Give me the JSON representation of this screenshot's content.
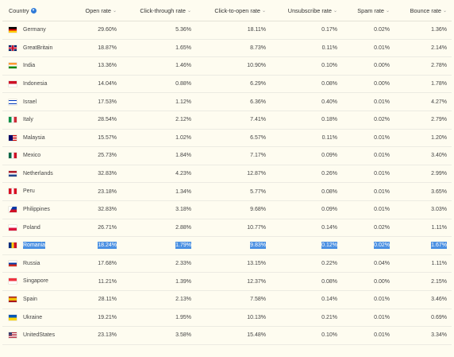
{
  "table": {
    "headers": {
      "country": "Country",
      "open_rate": "Open rate",
      "click_through_rate": "Click-through rate",
      "click_to_open_rate": "Click-to-open rate",
      "unsubscribe_rate": "Unsubscribe rate",
      "spam_rate": "Spam rate",
      "bounce_rate": "Bounce rate"
    },
    "rows": [
      {
        "country": "Germany",
        "flag": "flag-germany",
        "open": "29.60%",
        "ctr": "5.36%",
        "ctor": "18.11%",
        "unsub": "0.17%",
        "spam": "0.02%",
        "bounce": "1.36%"
      },
      {
        "country": "GreatBritain",
        "flag": "flag-great-britain",
        "open": "18.87%",
        "ctr": "1.65%",
        "ctor": "8.73%",
        "unsub": "0.11%",
        "spam": "0.01%",
        "bounce": "2.14%"
      },
      {
        "country": "India",
        "flag": "flag-india",
        "open": "13.36%",
        "ctr": "1.46%",
        "ctor": "10.90%",
        "unsub": "0.10%",
        "spam": "0.00%",
        "bounce": "2.78%"
      },
      {
        "country": "Indonesia",
        "flag": "flag-indonesia",
        "open": "14.04%",
        "ctr": "0.88%",
        "ctor": "6.29%",
        "unsub": "0.08%",
        "spam": "0.00%",
        "bounce": "1.78%"
      },
      {
        "country": "Israel",
        "flag": "flag-israel",
        "open": "17.53%",
        "ctr": "1.12%",
        "ctor": "6.36%",
        "unsub": "0.40%",
        "spam": "0.01%",
        "bounce": "4.27%"
      },
      {
        "country": "Italy",
        "flag": "flag-italy",
        "open": "28.54%",
        "ctr": "2.12%",
        "ctor": "7.41%",
        "unsub": "0.18%",
        "spam": "0.02%",
        "bounce": "2.79%"
      },
      {
        "country": "Malaysia",
        "flag": "flag-malaysia",
        "open": "15.57%",
        "ctr": "1.02%",
        "ctor": "6.57%",
        "unsub": "0.11%",
        "spam": "0.01%",
        "bounce": "1.20%"
      },
      {
        "country": "Mexico",
        "flag": "flag-mexico",
        "open": "25.73%",
        "ctr": "1.84%",
        "ctor": "7.17%",
        "unsub": "0.09%",
        "spam": "0.01%",
        "bounce": "3.40%"
      },
      {
        "country": "Netherlands",
        "flag": "flag-netherlands",
        "open": "32.83%",
        "ctr": "4.23%",
        "ctor": "12.87%",
        "unsub": "0.26%",
        "spam": "0.01%",
        "bounce": "2.99%"
      },
      {
        "country": "Peru",
        "flag": "flag-peru",
        "open": "23.18%",
        "ctr": "1.34%",
        "ctor": "5.77%",
        "unsub": "0.08%",
        "spam": "0.01%",
        "bounce": "3.65%"
      },
      {
        "country": "Philippines",
        "flag": "flag-philippines",
        "open": "32.83%",
        "ctr": "3.18%",
        "ctor": "9.68%",
        "unsub": "0.09%",
        "spam": "0.01%",
        "bounce": "3.03%"
      },
      {
        "country": "Poland",
        "flag": "flag-poland",
        "open": "26.71%",
        "ctr": "2.88%",
        "ctor": "10.77%",
        "unsub": "0.14%",
        "spam": "0.02%",
        "bounce": "1.11%"
      },
      {
        "country": "Romania",
        "flag": "flag-romania",
        "open": "18.24%",
        "ctr": "1.79%",
        "ctor": "9.83%",
        "unsub": "0.12%",
        "spam": "0.02%",
        "bounce": "1.67%"
      },
      {
        "country": "Russia",
        "flag": "flag-russia",
        "open": "17.68%",
        "ctr": "2.33%",
        "ctor": "13.15%",
        "unsub": "0.22%",
        "spam": "0.04%",
        "bounce": "1.11%"
      },
      {
        "country": "Singapore",
        "flag": "flag-singapore",
        "open": "11.21%",
        "ctr": "1.39%",
        "ctor": "12.37%",
        "unsub": "0.08%",
        "spam": "0.00%",
        "bounce": "2.15%"
      },
      {
        "country": "Spain",
        "flag": "flag-spain",
        "open": "28.11%",
        "ctr": "2.13%",
        "ctor": "7.58%",
        "unsub": "0.14%",
        "spam": "0.01%",
        "bounce": "3.46%"
      },
      {
        "country": "Ukraine",
        "flag": "flag-ukraine",
        "open": "19.21%",
        "ctr": "1.95%",
        "ctor": "10.13%",
        "unsub": "0.21%",
        "spam": "0.01%",
        "bounce": "0.69%"
      },
      {
        "country": "UnitedStates",
        "flag": "flag-united-states",
        "open": "23.13%",
        "ctr": "3.58%",
        "ctor": "15.48%",
        "unsub": "0.10%",
        "spam": "0.01%",
        "bounce": "3.34%"
      }
    ],
    "selected_row": "Romania",
    "sort_icon": "sort-chevron-icon",
    "active_sort_icon": "sort-active-icon"
  }
}
